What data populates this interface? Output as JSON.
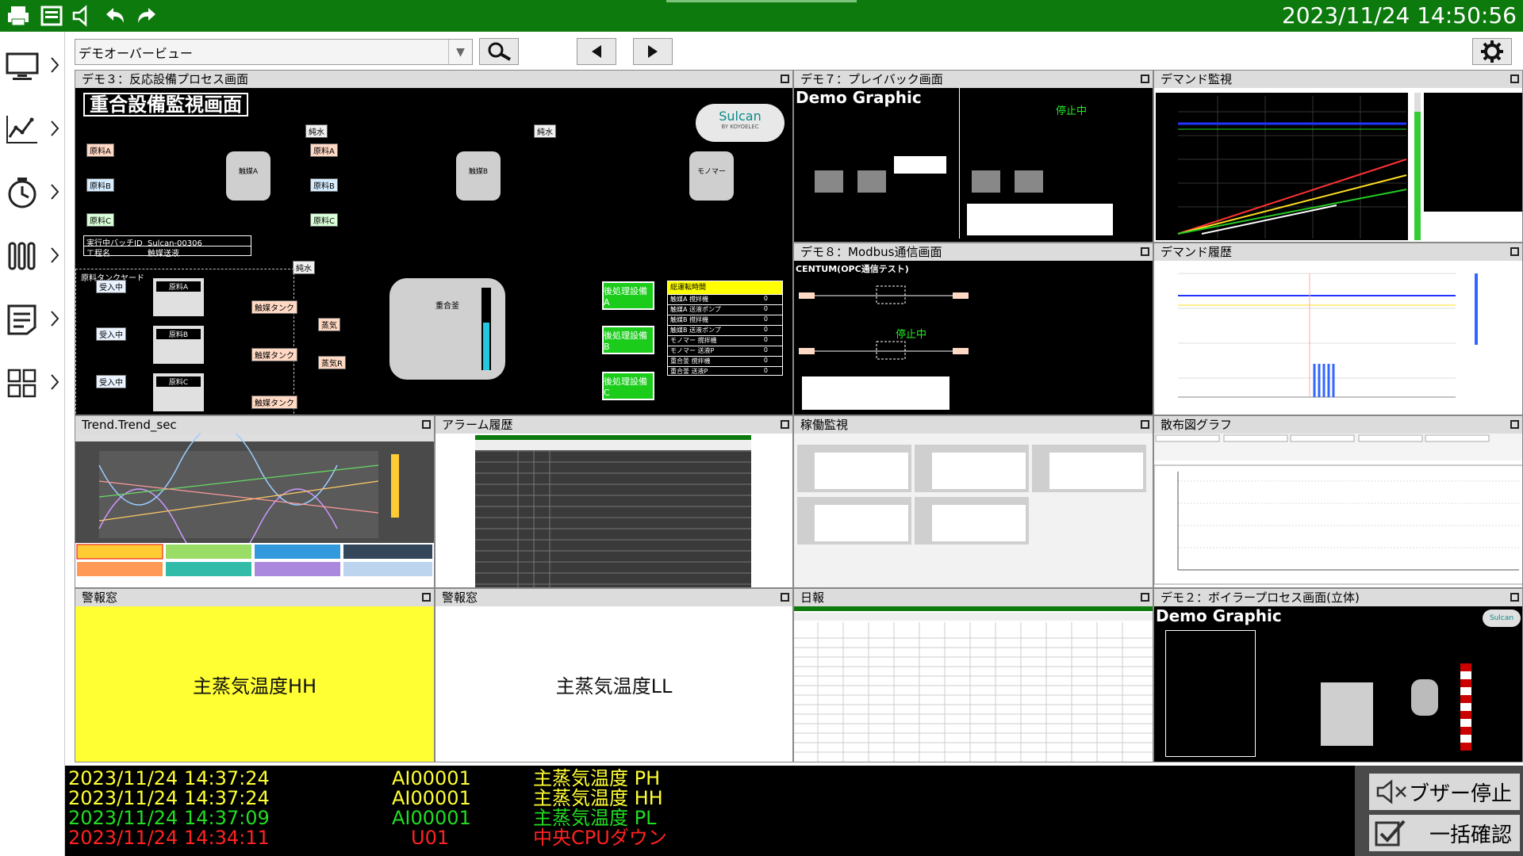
{
  "clock": "2023/11/24 14:50:56",
  "toolbar": {
    "view_select": "デモオーバービュー"
  },
  "panels": {
    "demo3": "デモ３：反応設備プロセス画面",
    "demo7": "デモ７：プレイバック画面",
    "demand": "デマンド監視",
    "demo8": "デモ８：Modbus通信画面",
    "demand_hist": "デマンド履歴",
    "trend": "Trend.Trend_sec",
    "alarm_hist": "アラーム履歴",
    "operation": "稼働監視",
    "scatter": "散布図グラフ",
    "keihou1": "警報窓",
    "keihou2": "警報窓",
    "daily": "日報",
    "demo2": "デモ２：ボイラープロセス画面(立体)"
  },
  "demo3": {
    "header": "重合設備監視画面",
    "logo": "Sulcan",
    "logo_sub": "BY KOYOELEC",
    "mats": [
      "原料A",
      "原料B",
      "原料C"
    ],
    "water": "純水",
    "catalysts": [
      "触媒A",
      "触媒B",
      "モノマー"
    ],
    "reactor": "重合釜",
    "steam": "蒸気",
    "steam_r": "蒸気R",
    "batch_id_label": "実行中バッチID",
    "batch_id": "Sulcan-00306",
    "process_label": "工程名",
    "process": "触媒送液",
    "runtime_title": "総運転時間",
    "runtime_rows": [
      [
        "触媒A 撹拌機",
        "0"
      ],
      [
        "触媒A 送液ポンプ",
        "0"
      ],
      [
        "触媒B 撹拌機",
        "0"
      ],
      [
        "触媒B 送液ポンプ",
        "0"
      ],
      [
        "モノマー 撹拌機",
        "0"
      ],
      [
        "モノマー 送液P",
        "0"
      ],
      [
        "重合釜 撹拌機",
        "0"
      ],
      [
        "重合釜 送液P",
        "0"
      ]
    ],
    "post": [
      "後処理設備A",
      "後処理設備B",
      "後処理設備C"
    ],
    "tank_yard": "原料タンクヤード",
    "receive": "受入中",
    "to_catalyst": "触媒タンク"
  },
  "demo7": {
    "title": "Demo Graphic",
    "stopped": "停止中"
  },
  "demo8": {
    "title": "CENTUM(OPC通信テスト)",
    "stopped": "停止中"
  },
  "demo2": {
    "title": "Demo Graphic",
    "logo": "Sulcan"
  },
  "keihou": {
    "left": "主蒸気温度HH",
    "right": "主蒸気温度LL"
  },
  "alarms": [
    {
      "time": "2023/11/24 14:37:24",
      "tag": "AI00001",
      "msg": "主蒸気温度 PH",
      "color": "#ffff33"
    },
    {
      "time": "2023/11/24 14:37:24",
      "tag": "AI00001",
      "msg": "主蒸気温度 HH",
      "color": "#ffff33"
    },
    {
      "time": "2023/11/24 14:37:09",
      "tag": "AI00001",
      "msg": "主蒸気温度 PL",
      "color": "#22dd22"
    },
    {
      "time": "2023/11/24 14:34:11",
      "tag": "U01",
      "msg": "中央CPUダウン",
      "color": "#ff2222"
    }
  ],
  "buttons": {
    "buzzer_stop": "ブザー停止",
    "confirm_all": "一括確認"
  },
  "colors": {
    "header": "#0d7a0d",
    "alarm_yellow": "#ffff33"
  }
}
